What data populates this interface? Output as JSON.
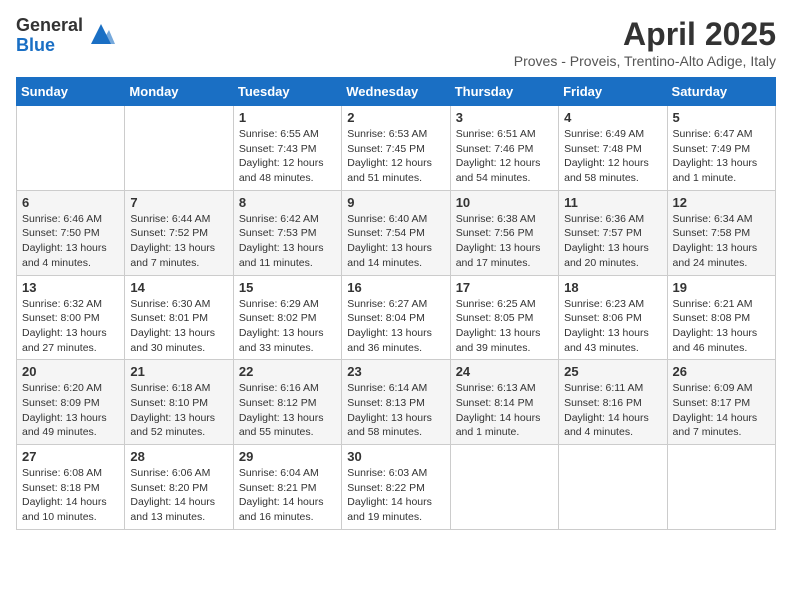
{
  "logo": {
    "general": "General",
    "blue": "Blue"
  },
  "title": "April 2025",
  "subtitle": "Proves - Proveis, Trentino-Alto Adige, Italy",
  "days_of_week": [
    "Sunday",
    "Monday",
    "Tuesday",
    "Wednesday",
    "Thursday",
    "Friday",
    "Saturday"
  ],
  "weeks": [
    [
      {
        "day": "",
        "info": ""
      },
      {
        "day": "",
        "info": ""
      },
      {
        "day": "1",
        "info": "Sunrise: 6:55 AM\nSunset: 7:43 PM\nDaylight: 12 hours and 48 minutes."
      },
      {
        "day": "2",
        "info": "Sunrise: 6:53 AM\nSunset: 7:45 PM\nDaylight: 12 hours and 51 minutes."
      },
      {
        "day": "3",
        "info": "Sunrise: 6:51 AM\nSunset: 7:46 PM\nDaylight: 12 hours and 54 minutes."
      },
      {
        "day": "4",
        "info": "Sunrise: 6:49 AM\nSunset: 7:48 PM\nDaylight: 12 hours and 58 minutes."
      },
      {
        "day": "5",
        "info": "Sunrise: 6:47 AM\nSunset: 7:49 PM\nDaylight: 13 hours and 1 minute."
      }
    ],
    [
      {
        "day": "6",
        "info": "Sunrise: 6:46 AM\nSunset: 7:50 PM\nDaylight: 13 hours and 4 minutes."
      },
      {
        "day": "7",
        "info": "Sunrise: 6:44 AM\nSunset: 7:52 PM\nDaylight: 13 hours and 7 minutes."
      },
      {
        "day": "8",
        "info": "Sunrise: 6:42 AM\nSunset: 7:53 PM\nDaylight: 13 hours and 11 minutes."
      },
      {
        "day": "9",
        "info": "Sunrise: 6:40 AM\nSunset: 7:54 PM\nDaylight: 13 hours and 14 minutes."
      },
      {
        "day": "10",
        "info": "Sunrise: 6:38 AM\nSunset: 7:56 PM\nDaylight: 13 hours and 17 minutes."
      },
      {
        "day": "11",
        "info": "Sunrise: 6:36 AM\nSunset: 7:57 PM\nDaylight: 13 hours and 20 minutes."
      },
      {
        "day": "12",
        "info": "Sunrise: 6:34 AM\nSunset: 7:58 PM\nDaylight: 13 hours and 24 minutes."
      }
    ],
    [
      {
        "day": "13",
        "info": "Sunrise: 6:32 AM\nSunset: 8:00 PM\nDaylight: 13 hours and 27 minutes."
      },
      {
        "day": "14",
        "info": "Sunrise: 6:30 AM\nSunset: 8:01 PM\nDaylight: 13 hours and 30 minutes."
      },
      {
        "day": "15",
        "info": "Sunrise: 6:29 AM\nSunset: 8:02 PM\nDaylight: 13 hours and 33 minutes."
      },
      {
        "day": "16",
        "info": "Sunrise: 6:27 AM\nSunset: 8:04 PM\nDaylight: 13 hours and 36 minutes."
      },
      {
        "day": "17",
        "info": "Sunrise: 6:25 AM\nSunset: 8:05 PM\nDaylight: 13 hours and 39 minutes."
      },
      {
        "day": "18",
        "info": "Sunrise: 6:23 AM\nSunset: 8:06 PM\nDaylight: 13 hours and 43 minutes."
      },
      {
        "day": "19",
        "info": "Sunrise: 6:21 AM\nSunset: 8:08 PM\nDaylight: 13 hours and 46 minutes."
      }
    ],
    [
      {
        "day": "20",
        "info": "Sunrise: 6:20 AM\nSunset: 8:09 PM\nDaylight: 13 hours and 49 minutes."
      },
      {
        "day": "21",
        "info": "Sunrise: 6:18 AM\nSunset: 8:10 PM\nDaylight: 13 hours and 52 minutes."
      },
      {
        "day": "22",
        "info": "Sunrise: 6:16 AM\nSunset: 8:12 PM\nDaylight: 13 hours and 55 minutes."
      },
      {
        "day": "23",
        "info": "Sunrise: 6:14 AM\nSunset: 8:13 PM\nDaylight: 13 hours and 58 minutes."
      },
      {
        "day": "24",
        "info": "Sunrise: 6:13 AM\nSunset: 8:14 PM\nDaylight: 14 hours and 1 minute."
      },
      {
        "day": "25",
        "info": "Sunrise: 6:11 AM\nSunset: 8:16 PM\nDaylight: 14 hours and 4 minutes."
      },
      {
        "day": "26",
        "info": "Sunrise: 6:09 AM\nSunset: 8:17 PM\nDaylight: 14 hours and 7 minutes."
      }
    ],
    [
      {
        "day": "27",
        "info": "Sunrise: 6:08 AM\nSunset: 8:18 PM\nDaylight: 14 hours and 10 minutes."
      },
      {
        "day": "28",
        "info": "Sunrise: 6:06 AM\nSunset: 8:20 PM\nDaylight: 14 hours and 13 minutes."
      },
      {
        "day": "29",
        "info": "Sunrise: 6:04 AM\nSunset: 8:21 PM\nDaylight: 14 hours and 16 minutes."
      },
      {
        "day": "30",
        "info": "Sunrise: 6:03 AM\nSunset: 8:22 PM\nDaylight: 14 hours and 19 minutes."
      },
      {
        "day": "",
        "info": ""
      },
      {
        "day": "",
        "info": ""
      },
      {
        "day": "",
        "info": ""
      }
    ]
  ]
}
